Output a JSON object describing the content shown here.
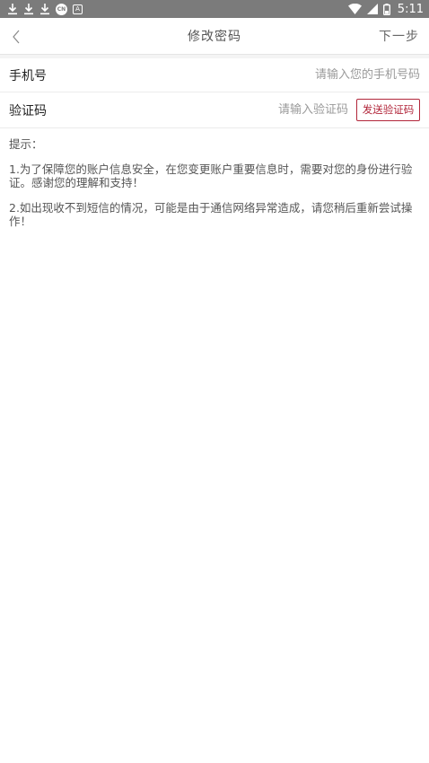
{
  "status_bar": {
    "time": "5:11",
    "left_icons": [
      "download-icon",
      "download-icon",
      "download-icon",
      "app-round-icon",
      "app-square-icon"
    ],
    "right_icons": [
      "wifi-icon",
      "signal-icon",
      "battery-icon"
    ],
    "round_icon_text": "CN",
    "square_icon_text": "A"
  },
  "nav": {
    "title": "修改密码",
    "next_label": "下一步"
  },
  "form": {
    "phone_label": "手机号",
    "phone_placeholder": "请输入您的手机号码",
    "code_label": "验证码",
    "code_placeholder": "请输入验证码",
    "send_code_label": "发送验证码"
  },
  "tips": {
    "title": "提示：",
    "items": [
      "1.为了保障您的账户信息安全，在您变更账户重要信息时，需要对您的身份进行验证。感谢您的理解和支持！",
      "2.如出现收不到短信的情况，可能是由于通信网络异常造成，请您稍后重新尝试操作！"
    ]
  },
  "colors": {
    "status_bar": "#7b7b7b",
    "accent": "#b2263a"
  }
}
